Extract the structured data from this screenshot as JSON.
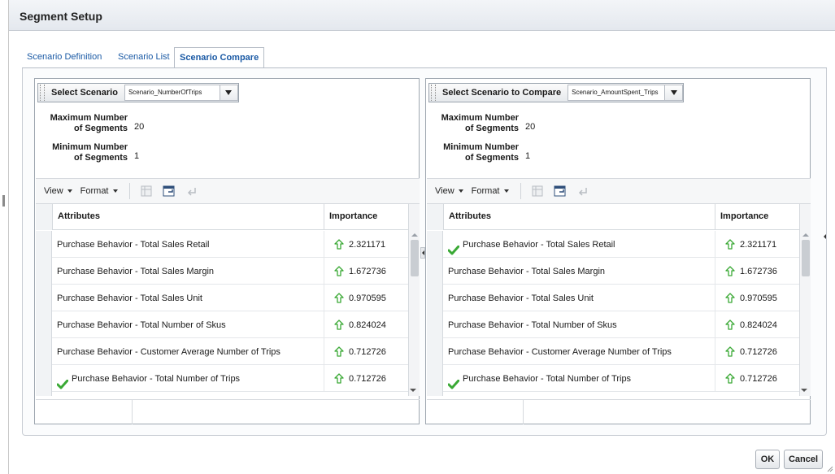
{
  "dialog": {
    "title": "Segment Setup"
  },
  "tabs": [
    {
      "label": "Scenario Definition",
      "active": false
    },
    {
      "label": "Scenario List",
      "active": false
    },
    {
      "label": "Scenario Compare",
      "active": true
    }
  ],
  "left_panel": {
    "select_label": "Select Scenario",
    "select_value": "Scenario_NumberOfTrips",
    "max_label": "Maximum Number of Segments",
    "max_value": "20",
    "min_label": "Minimum Number of Segments",
    "min_value": "1",
    "view_menu": "View",
    "format_menu": "Format",
    "columns": {
      "attributes": "Attributes",
      "importance": "Importance"
    },
    "rows": [
      {
        "attribute": "Purchase Behavior - Total Sales Retail",
        "importance": "2.321171",
        "checked": false
      },
      {
        "attribute": "Purchase Behavior - Total Sales Margin",
        "importance": "1.672736",
        "checked": false
      },
      {
        "attribute": "Purchase Behavior - Total Sales Unit",
        "importance": "0.970595",
        "checked": false
      },
      {
        "attribute": "Purchase Behavior - Total Number of Skus",
        "importance": "0.824024",
        "checked": false
      },
      {
        "attribute": "Purchase Behavior - Customer Average Number of Trips",
        "importance": "0.712726",
        "checked": false
      },
      {
        "attribute": "Purchase Behavior - Total Number of Trips",
        "importance": "0.712726",
        "checked": true
      }
    ]
  },
  "right_panel": {
    "select_label": "Select Scenario to Compare",
    "select_value": "Scenario_AmountSpent_Trips",
    "max_label": "Maximum Number of Segments",
    "max_value": "20",
    "min_label": "Minimum Number of Segments",
    "min_value": "1",
    "view_menu": "View",
    "format_menu": "Format",
    "columns": {
      "attributes": "Attributes",
      "importance": "Importance"
    },
    "rows": [
      {
        "attribute": "Purchase Behavior - Total Sales Retail",
        "importance": "2.321171",
        "checked": true
      },
      {
        "attribute": "Purchase Behavior - Total Sales Margin",
        "importance": "1.672736",
        "checked": false
      },
      {
        "attribute": "Purchase Behavior - Total Sales Unit",
        "importance": "0.970595",
        "checked": false
      },
      {
        "attribute": "Purchase Behavior - Total Number of Skus",
        "importance": "0.824024",
        "checked": false
      },
      {
        "attribute": "Purchase Behavior - Customer Average Number of Trips",
        "importance": "0.712726",
        "checked": false
      },
      {
        "attribute": "Purchase Behavior - Total Number of Trips",
        "importance": "0.712726",
        "checked": true
      }
    ]
  },
  "buttons": {
    "ok": "OK",
    "cancel": "Cancel"
  },
  "colors": {
    "link": "#1b5aa5",
    "check": "#3aa935",
    "arrow": "#3aa935"
  },
  "icons": [
    "check-icon",
    "up-arrow-icon",
    "freeze-icon",
    "detach-icon",
    "wrap-icon",
    "dropdown-caret-icon"
  ]
}
